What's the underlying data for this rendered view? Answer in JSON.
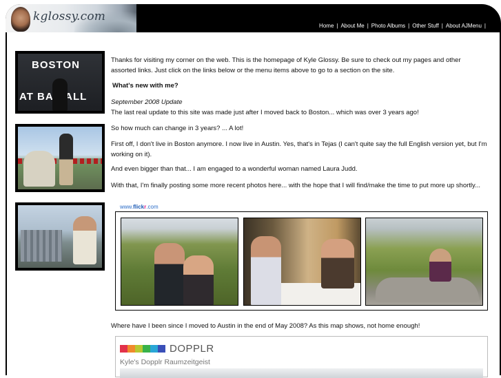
{
  "site": {
    "logo_text": "kglossy.com"
  },
  "nav": {
    "items": [
      {
        "label": "Home"
      },
      {
        "label": "About Me"
      },
      {
        "label": "Photo Albums"
      },
      {
        "label": "Other Stuff"
      },
      {
        "label": "About AJMenu"
      }
    ],
    "separator": "|"
  },
  "sidebar_photos": {
    "boston_sign_top": "BOSTON",
    "boston_sign_bottom": "AT BA    BALL"
  },
  "content": {
    "intro": "Thanks for visiting my corner on the web. This is the homepage of Kyle Glossy. Be sure to check out my pages and other assorted links. Just click on the links below or the menu items above to go to a section on the site.",
    "whats_new_heading": "What's new with me?",
    "update_date": "September 2008 Update",
    "update_line": "The last real update to this site was made just after I moved back to Boston... which was over 3 years ago!",
    "change_question": "So how much can change in 3 years? ... A lot!",
    "austin_paragraph": "First off, I don't live in Boston anymore. I now live in Austin. Yes, that's in Tejas (I can't quite say the full English version yet, but I'm working on it).",
    "engaged_paragraph": "And even bigger than that... I am engaged to a wonderful woman named Laura Judd.",
    "photos_paragraph": "With that, I'm finally posting some more recent photos here... with the hope that I will find/make the time to put more up shortly...",
    "where_paragraph": "Where have I been since I moved to Austin in the end of May 2008? As this map shows, not home enough!"
  },
  "flickr": {
    "prefix": "www.",
    "brand_a": "flick",
    "brand_b": "r",
    "suffix": ".com"
  },
  "dopplr": {
    "brand": "DOPPLR",
    "subtitle": "Kyle's Dopplr Raumzeitgeist",
    "colors": [
      "#e2324a",
      "#f08a2c",
      "#b7c832",
      "#38b24a",
      "#2aa6d6",
      "#3a4fb8"
    ]
  }
}
